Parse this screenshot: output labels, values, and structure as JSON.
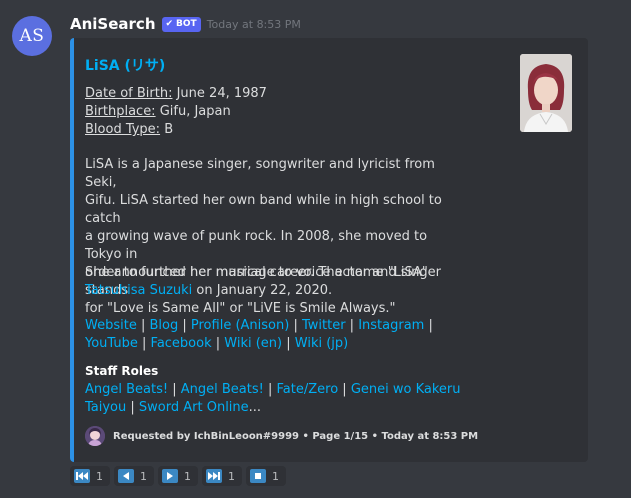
{
  "message": {
    "avatar_initials": "AS",
    "username": "AniSearch",
    "bot_tag": "BOT",
    "timestamp": "Today at 8:53 PM"
  },
  "embed": {
    "accent_color": "#2c91e6",
    "title": "LiSA (リサ)",
    "fields": {
      "dob_label": "Date of Birth:",
      "dob_value": " June 24, 1987",
      "birthplace_label": "Birthplace:",
      "birthplace_value": " Gifu, Japan",
      "blood_label": "Blood Type:",
      "blood_value": " B"
    },
    "bio": {
      "lines": [
        "LiSA is a Japanese singer, songwriter and lyricist from Seki,",
        "Gifu. LiSA started her own band while in high school to catch",
        "a growing wave of punk rock. In 2008, she moved to Tokyo in",
        "order to further her musical career. The name \"LiSA\" stands",
        "for \"Love is Same All\" or \"LiVE is Smile Always.\""
      ],
      "marriage_line1": "She announced her marriage to voice actor and singer",
      "marriage_link": "Tatsuhisa Suzuki",
      "marriage_line2_rest": " on January 22, 2020."
    },
    "links": {
      "website": "Website",
      "blog": "Blog",
      "profile": "Profile (Anison)",
      "twitter": "Twitter",
      "instagram": "Instagram",
      "youtube": "YouTube",
      "facebook": "Facebook",
      "wiki_en": "Wiki (en)",
      "wiki_jp": "Wiki (jp)",
      "separator": " | "
    },
    "staff_roles": {
      "title": "Staff Roles",
      "items": [
        "Angel Beats!",
        "Angel Beats!",
        "Fate/Zero",
        "Genei wo Kakeru",
        "Taiyou",
        "Sword Art Online"
      ],
      "ellipsis": "..."
    },
    "footer": {
      "text": "Requested by IchBinLeoon#9999 • Page 1/15 • Today at 8:53 PM"
    }
  },
  "reactions": [
    {
      "icon": "first-page-icon",
      "count": "1"
    },
    {
      "icon": "previous-page-icon",
      "count": "1"
    },
    {
      "icon": "next-page-icon",
      "count": "1"
    },
    {
      "icon": "last-page-icon",
      "count": "1"
    },
    {
      "icon": "stop-icon",
      "count": "1"
    }
  ]
}
